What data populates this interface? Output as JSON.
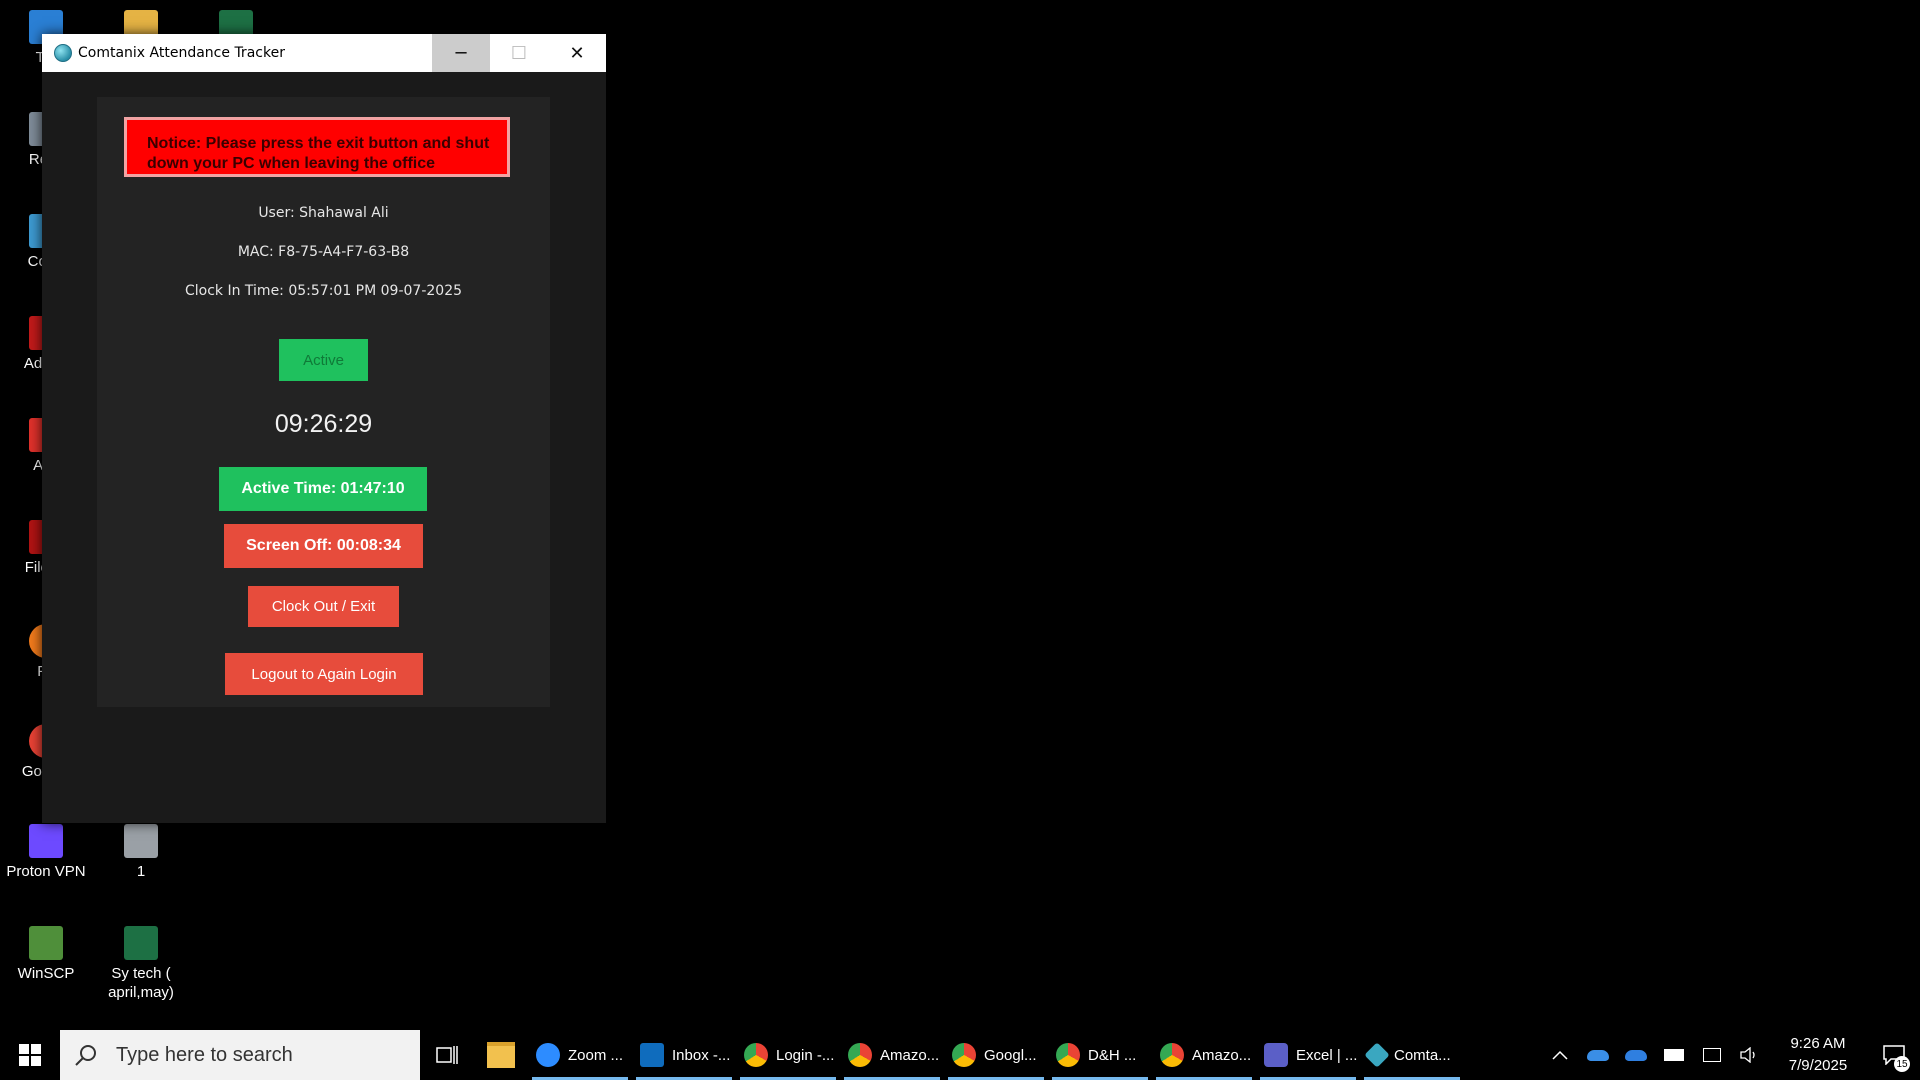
{
  "desktop": {
    "icons": [
      {
        "label": "Thi",
        "icon": "this-pc-icon"
      },
      {
        "label": "Recy",
        "icon": "recycle-bin-icon"
      },
      {
        "label": "Contr",
        "icon": "control-panel-icon"
      },
      {
        "label": "Ad Acr",
        "icon": "acrobat-icon"
      },
      {
        "label": "Any",
        "icon": "anydesk-icon"
      },
      {
        "label": "File Cl",
        "icon": "filezilla-icon"
      },
      {
        "label": "Fir",
        "icon": "firefox-icon"
      },
      {
        "label": "Go Chr",
        "icon": "chrome-icon"
      },
      {
        "label": "Proton VPN",
        "icon": "proton-vpn-icon"
      },
      {
        "label": "1",
        "icon": "file-icon"
      },
      {
        "label": "WinSCP",
        "icon": "winscp-icon"
      },
      {
        "label": "Sy tech ( april,may)",
        "icon": "excel-icon"
      }
    ]
  },
  "window": {
    "title": "Comtanix Attendance Tracker",
    "minimize": "─",
    "maximize": "☐",
    "close": "✕"
  },
  "tracker": {
    "notice": "Notice: Please press the exit button and shut down your PC when leaving the office",
    "user": "User: Shahawal Ali",
    "mac": "MAC: F8-75-A4-F7-63-B8",
    "clock_in": "Clock In Time: 05:57:01 PM 09-07-2025",
    "status": "Active",
    "clock": "09:26:29",
    "active_time": "Active Time: 01:47:10",
    "screen_off": "Screen Off: 00:08:34",
    "clock_out_label": "Clock Out / Exit",
    "logout_label": "Logout to Again Login"
  },
  "taskbar": {
    "search_placeholder": "Type here to search",
    "apps": [
      {
        "label": "Zoom ...",
        "icon": "zoom-icon",
        "color": "#2d8cff"
      },
      {
        "label": "Inbox -...",
        "icon": "outlook-icon",
        "color": "#0f6cbd"
      },
      {
        "label": "Login -...",
        "icon": "chrome-icon",
        "color": "#ea4335"
      },
      {
        "label": "Amazo...",
        "icon": "chrome-icon",
        "color": "#ea4335"
      },
      {
        "label": "Googl...",
        "icon": "chrome-icon",
        "color": "#ea4335"
      },
      {
        "label": "D&H ...",
        "icon": "chrome-icon",
        "color": "#ea4335"
      },
      {
        "label": "Amazo...",
        "icon": "chrome-icon",
        "color": "#ea4335"
      },
      {
        "label": "Excel | ...",
        "icon": "teams-icon",
        "color": "#5b5fc7"
      },
      {
        "label": "Comta...",
        "icon": "comtanix-icon",
        "color": "#3aa7c0"
      }
    ],
    "time": "9:26 AM",
    "date": "7/9/2025",
    "notification_count": "15"
  }
}
